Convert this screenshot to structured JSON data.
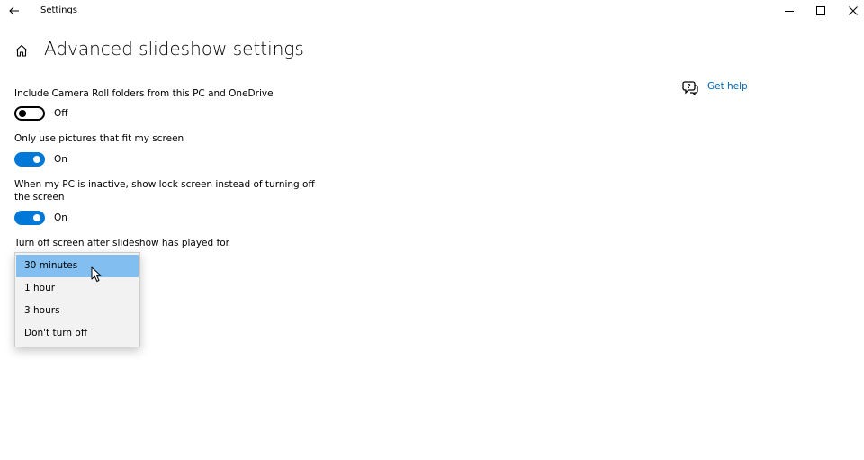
{
  "window": {
    "title": "Settings",
    "controls": [
      "minimize-icon",
      "maximize-icon",
      "close-icon"
    ]
  },
  "page": {
    "title": "Advanced slideshow settings"
  },
  "settings": {
    "camera_roll": {
      "label": "Include Camera Roll folders from this PC and OneDrive",
      "state": "Off",
      "on": false
    },
    "fit_screen": {
      "label": "Only use pictures that fit my screen",
      "state": "On",
      "on": true
    },
    "lock_screen": {
      "label": "When my PC is inactive, show lock screen instead of turning off the screen",
      "state": "On",
      "on": true
    },
    "turn_off": {
      "label": "Turn off screen after slideshow has played for",
      "options": [
        "30 minutes",
        "1 hour",
        "3 hours",
        "Don't turn off"
      ],
      "selected": "30 minutes"
    }
  },
  "help": {
    "label": "Get help"
  },
  "colors": {
    "accent": "#0078d7",
    "link": "#0067b8",
    "dropdown_highlight": "#82bff0"
  }
}
